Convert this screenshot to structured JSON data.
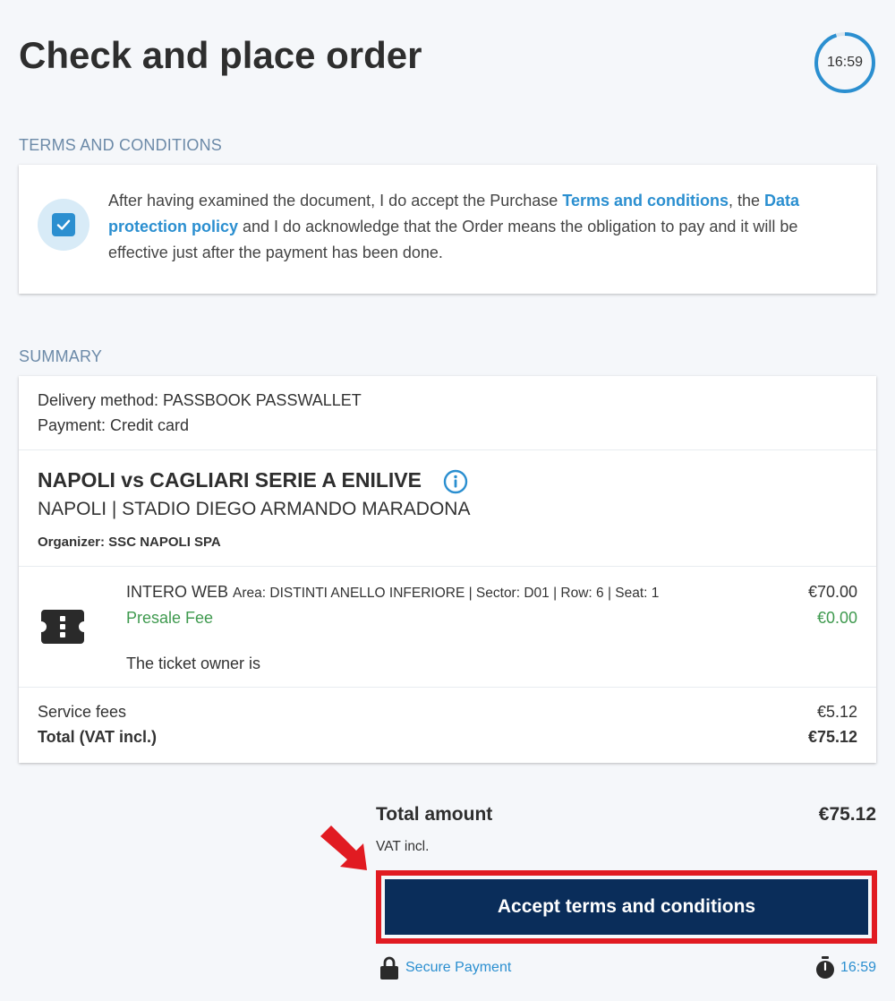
{
  "page": {
    "title": "Check and place order",
    "timer": "16:59",
    "timer_progress": 0.95
  },
  "terms": {
    "section_label": "TERMS AND CONDITIONS",
    "checked": true,
    "text_before": "After having examined the document, I do accept the Purchase ",
    "link_terms": "Terms and conditions",
    "text_middle": ", the ",
    "link_privacy": "Data protection policy",
    "text_after": " and I do acknowledge that the Order means the obligation to pay and it will be effective just after the payment has been done."
  },
  "summary": {
    "section_label": "SUMMARY",
    "delivery": "Delivery method: PASSBOOK PASSWALLET",
    "payment": "Payment: Credit card",
    "event_title": "NAPOLI vs CAGLIARI SERIE A ENILIVE",
    "venue": "NAPOLI | STADIO DIEGO ARMANDO MARADONA",
    "organizer": "Organizer: SSC NAPOLI SPA",
    "ticket": {
      "type": "INTERO WEB",
      "details": "Area: DISTINTI ANELLO INFERIORE | Sector: D01 | Row: 6 | Seat: 1",
      "price": "€70.00",
      "fee_label": "Presale Fee",
      "fee_value": "€0.00",
      "owner_label": "The ticket owner is"
    },
    "service_fees_label": "Service fees",
    "service_fees_value": "€5.12",
    "total_label": "Total (VAT incl.)",
    "total_value": "€75.12"
  },
  "footer": {
    "total_amount_label": "Total amount",
    "total_amount_value": "€75.12",
    "vat_note": "VAT incl.",
    "cta_label": "Accept terms and conditions",
    "secure_label": "Secure Payment",
    "timer": "16:59"
  },
  "colors": {
    "accent": "#2b8fd0",
    "cta_bg": "#0a2d5a",
    "highlight": "#e11b22",
    "fee_green": "#3f9a4f"
  },
  "icons": [
    "checkbox-checked-icon",
    "info-icon",
    "ticket-icon",
    "lock-icon",
    "stopwatch-icon",
    "red-arrow-icon"
  ]
}
